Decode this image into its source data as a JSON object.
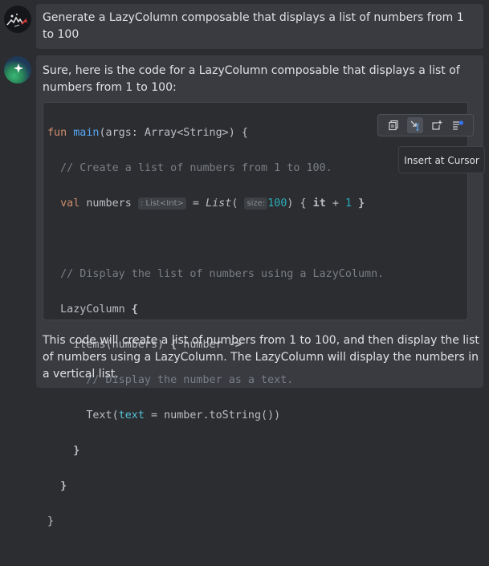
{
  "user_message": {
    "text": "Generate a LazyColumn composable that displays a list of numbers from 1 to 100"
  },
  "bot_message": {
    "intro": "Sure, here is the code for a LazyColumn composable that displays a list of numbers from 1 to 100:",
    "outro": "This code will create a list of numbers from 1 to 100, and then display the list of numbers using a LazyColumn. The LazyColumn will display the numbers in a vertical list."
  },
  "code": {
    "l1_fun": "fun",
    "l1_main": "main",
    "l1_rest": "(args: Array<String>) {",
    "l2_comment": "// Create a list of numbers from 1 to 100.",
    "l3_val": "val",
    "l3_numbers": " numbers",
    "l3_type_hint": ": List<Int>",
    "l3_eq": " = ",
    "l3_list": "List",
    "l3_paren": "(",
    "l3_size_hint": "size:",
    "l3_100": "100",
    "l3_mid": ") { ",
    "l3_it": "it",
    "l3_plus": " + ",
    "l3_one": "1",
    "l3_end": " }",
    "l5_comment": "// Display the list of numbers using a LazyColumn.",
    "l6_lazy": "LazyColumn",
    "l6_brace": " {",
    "l7_items": "items(numbers) ",
    "l7_brace": "{",
    "l7_number": " number ",
    "l7_arrow": "->",
    "l8_comment": "// Display the number as a text.",
    "l9_text": "Text(",
    "l9_param": "text",
    "l9_rest": " = number.toString())",
    "l10": "}",
    "l11": "}",
    "l12": "}"
  },
  "toolbar": {
    "icons": [
      "copy-icon",
      "insert-at-cursor-icon",
      "insert-in-new-file-icon",
      "insert-into-terminal-icon"
    ]
  },
  "tooltip": {
    "text": "Insert at Cursor"
  }
}
